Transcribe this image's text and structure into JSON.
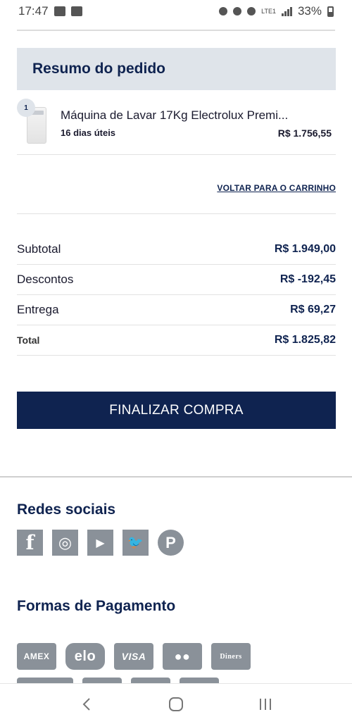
{
  "status_bar": {
    "time": "17:47",
    "battery": "33%",
    "network": "LTE1"
  },
  "summary": {
    "title": "Resumo do pedido",
    "item": {
      "quantity": "1",
      "name": "Máquina de Lavar 17Kg Electrolux Premi...",
      "delivery": "16 dias úteis",
      "price": "R$ 1.756,55"
    },
    "back_link": "VOLTAR PARA O CARRINHO"
  },
  "totals": {
    "subtotal_label": "Subtotal",
    "subtotal_value": "R$ 1.949,00",
    "discount_label": "Descontos",
    "discount_value": "R$ -192,45",
    "delivery_label": "Entrega",
    "delivery_value": "R$ 69,27",
    "total_label": "Total",
    "total_value": "R$ 1.825,82"
  },
  "checkout_button": "FINALIZAR COMPRA",
  "footer": {
    "social_title": "Redes sociais",
    "social": [
      {
        "name": "facebook-icon",
        "glyph": "f"
      },
      {
        "name": "instagram-icon",
        "glyph": "◎"
      },
      {
        "name": "youtube-icon",
        "glyph": "▶"
      },
      {
        "name": "twitter-icon",
        "glyph": "🐦"
      },
      {
        "name": "pinterest-icon",
        "glyph": "P"
      }
    ],
    "payment_title": "Formas de Pagamento",
    "payments_row1": [
      {
        "name": "amex-icon",
        "label": "AMEX"
      },
      {
        "name": "elo-icon",
        "label": "elo"
      },
      {
        "name": "visa-icon",
        "label": "VISA"
      },
      {
        "name": "mastercard-icon",
        "label": "●●"
      },
      {
        "name": "diners-icon",
        "label": "Diners"
      }
    ]
  },
  "colors": {
    "brand_navy": "#0f2350",
    "header_bg": "#dfe4ea",
    "icon_gray": "#8a9199"
  }
}
